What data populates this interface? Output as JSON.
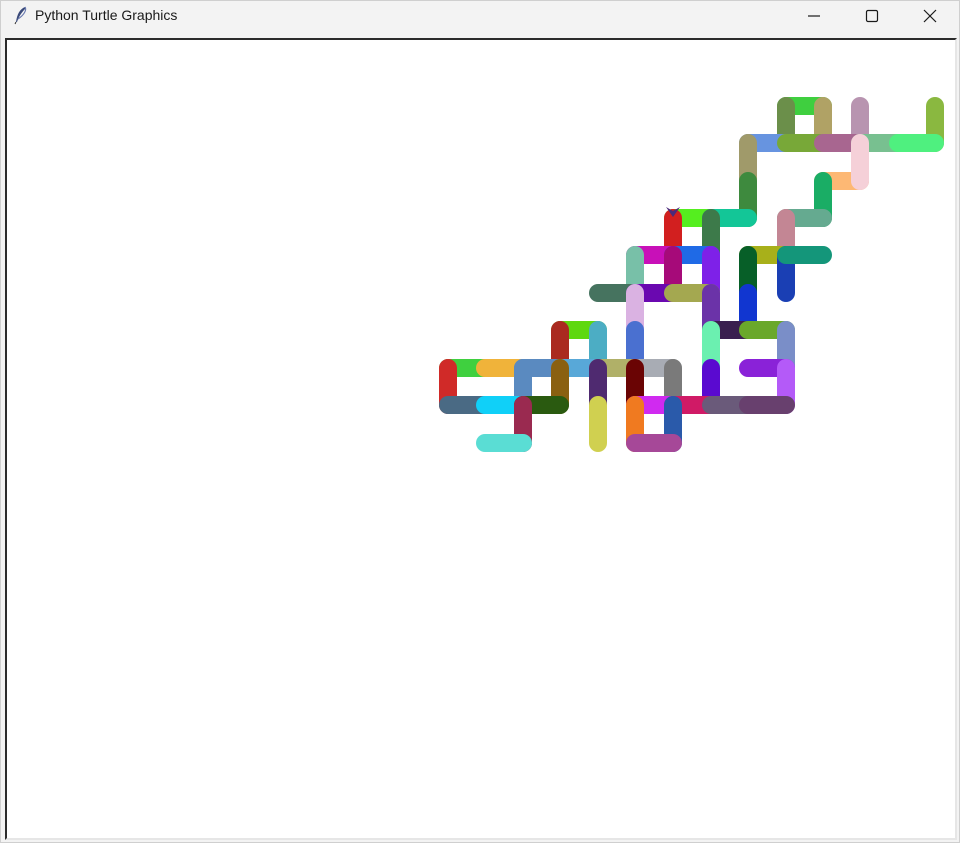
{
  "window": {
    "title": "Python Turtle Graphics",
    "app_icon": "feather-icon",
    "controls": [
      "minimize-icon",
      "maximize-icon",
      "close-icon"
    ]
  },
  "canvas": {
    "background": "#ffffff",
    "turtle_color": "#4b2a7a",
    "stroke_colors": {
      "primary_palette": [
        "#3fcf3f",
        "#6b8f4a",
        "#b0a265",
        "#b894b0",
        "#8ab840",
        "#6794e0",
        "#78a838",
        "#a86690",
        "#78c090",
        "#4ff07f",
        "#a09a6a",
        "#3e8a3e",
        "#fdb874",
        "#f5d0d8",
        "#1aad65",
        "#55ee1f",
        "#13c697",
        "#d21f1f",
        "#3d7a4a",
        "#65aa90",
        "#c38694",
        "#14967a",
        "#c810b8",
        "#1f6ae6",
        "#78c0a8",
        "#a60a79",
        "#7e21e8",
        "#a8b01a",
        "#075f28",
        "#1a3fb4"
      ]
    }
  }
}
